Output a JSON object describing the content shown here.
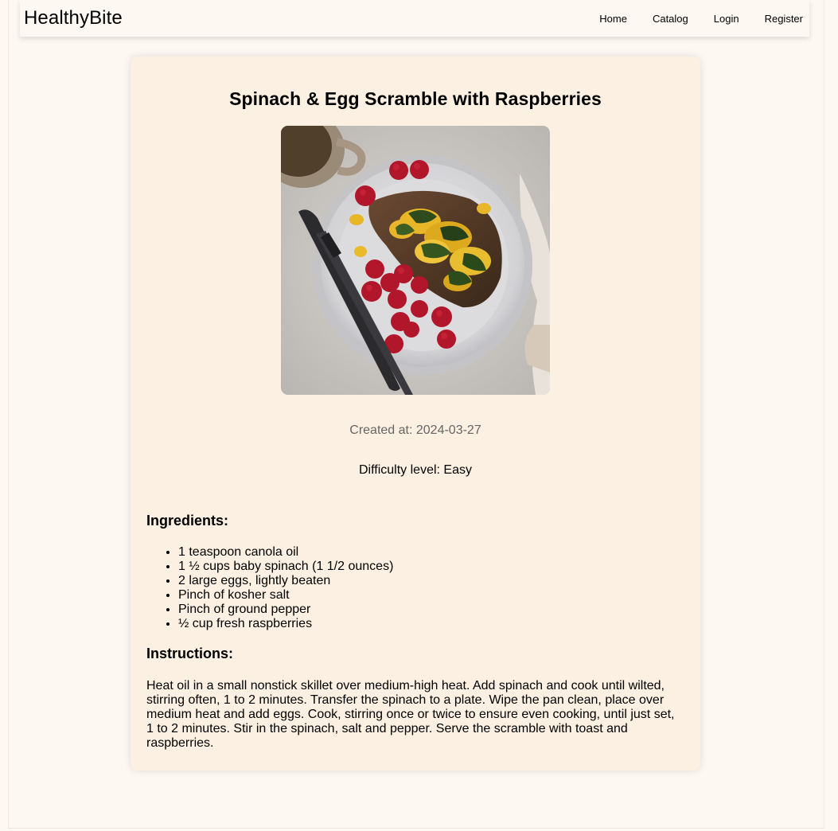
{
  "brand": "HealthyBite",
  "nav": {
    "home": "Home",
    "catalog": "Catalog",
    "login": "Login",
    "register": "Register"
  },
  "recipe": {
    "title": "Spinach & Egg Scramble with Raspberries",
    "created_label": "Created at: 2024-03-27",
    "difficulty_label": "Difficulty level: Easy",
    "ingredients_heading": "Ingredients:",
    "ingredients": [
      "1 teaspoon canola oil",
      "1 ½ cups baby spinach (1 1/2 ounces)",
      "2 large eggs, lightly beaten",
      "Pinch of kosher salt",
      "Pinch of ground pepper",
      "½ cup fresh raspberries"
    ],
    "instructions_heading": "Instructions:",
    "instructions": "Heat oil in a small nonstick skillet over medium-high heat. Add spinach and cook until wilted, stirring often, 1 to 2 minutes. Transfer the spinach to a plate. Wipe the pan clean, place over medium heat and add eggs. Cook, stirring once or twice to ensure even cooking, until just set, 1 to 2 minutes. Stir in the spinach, salt and pepper. Serve the scramble with toast and raspberries."
  },
  "colors": {
    "page_background": "#fdf8f2",
    "card_background": "#fbf0e1",
    "muted_text": "#666666"
  }
}
